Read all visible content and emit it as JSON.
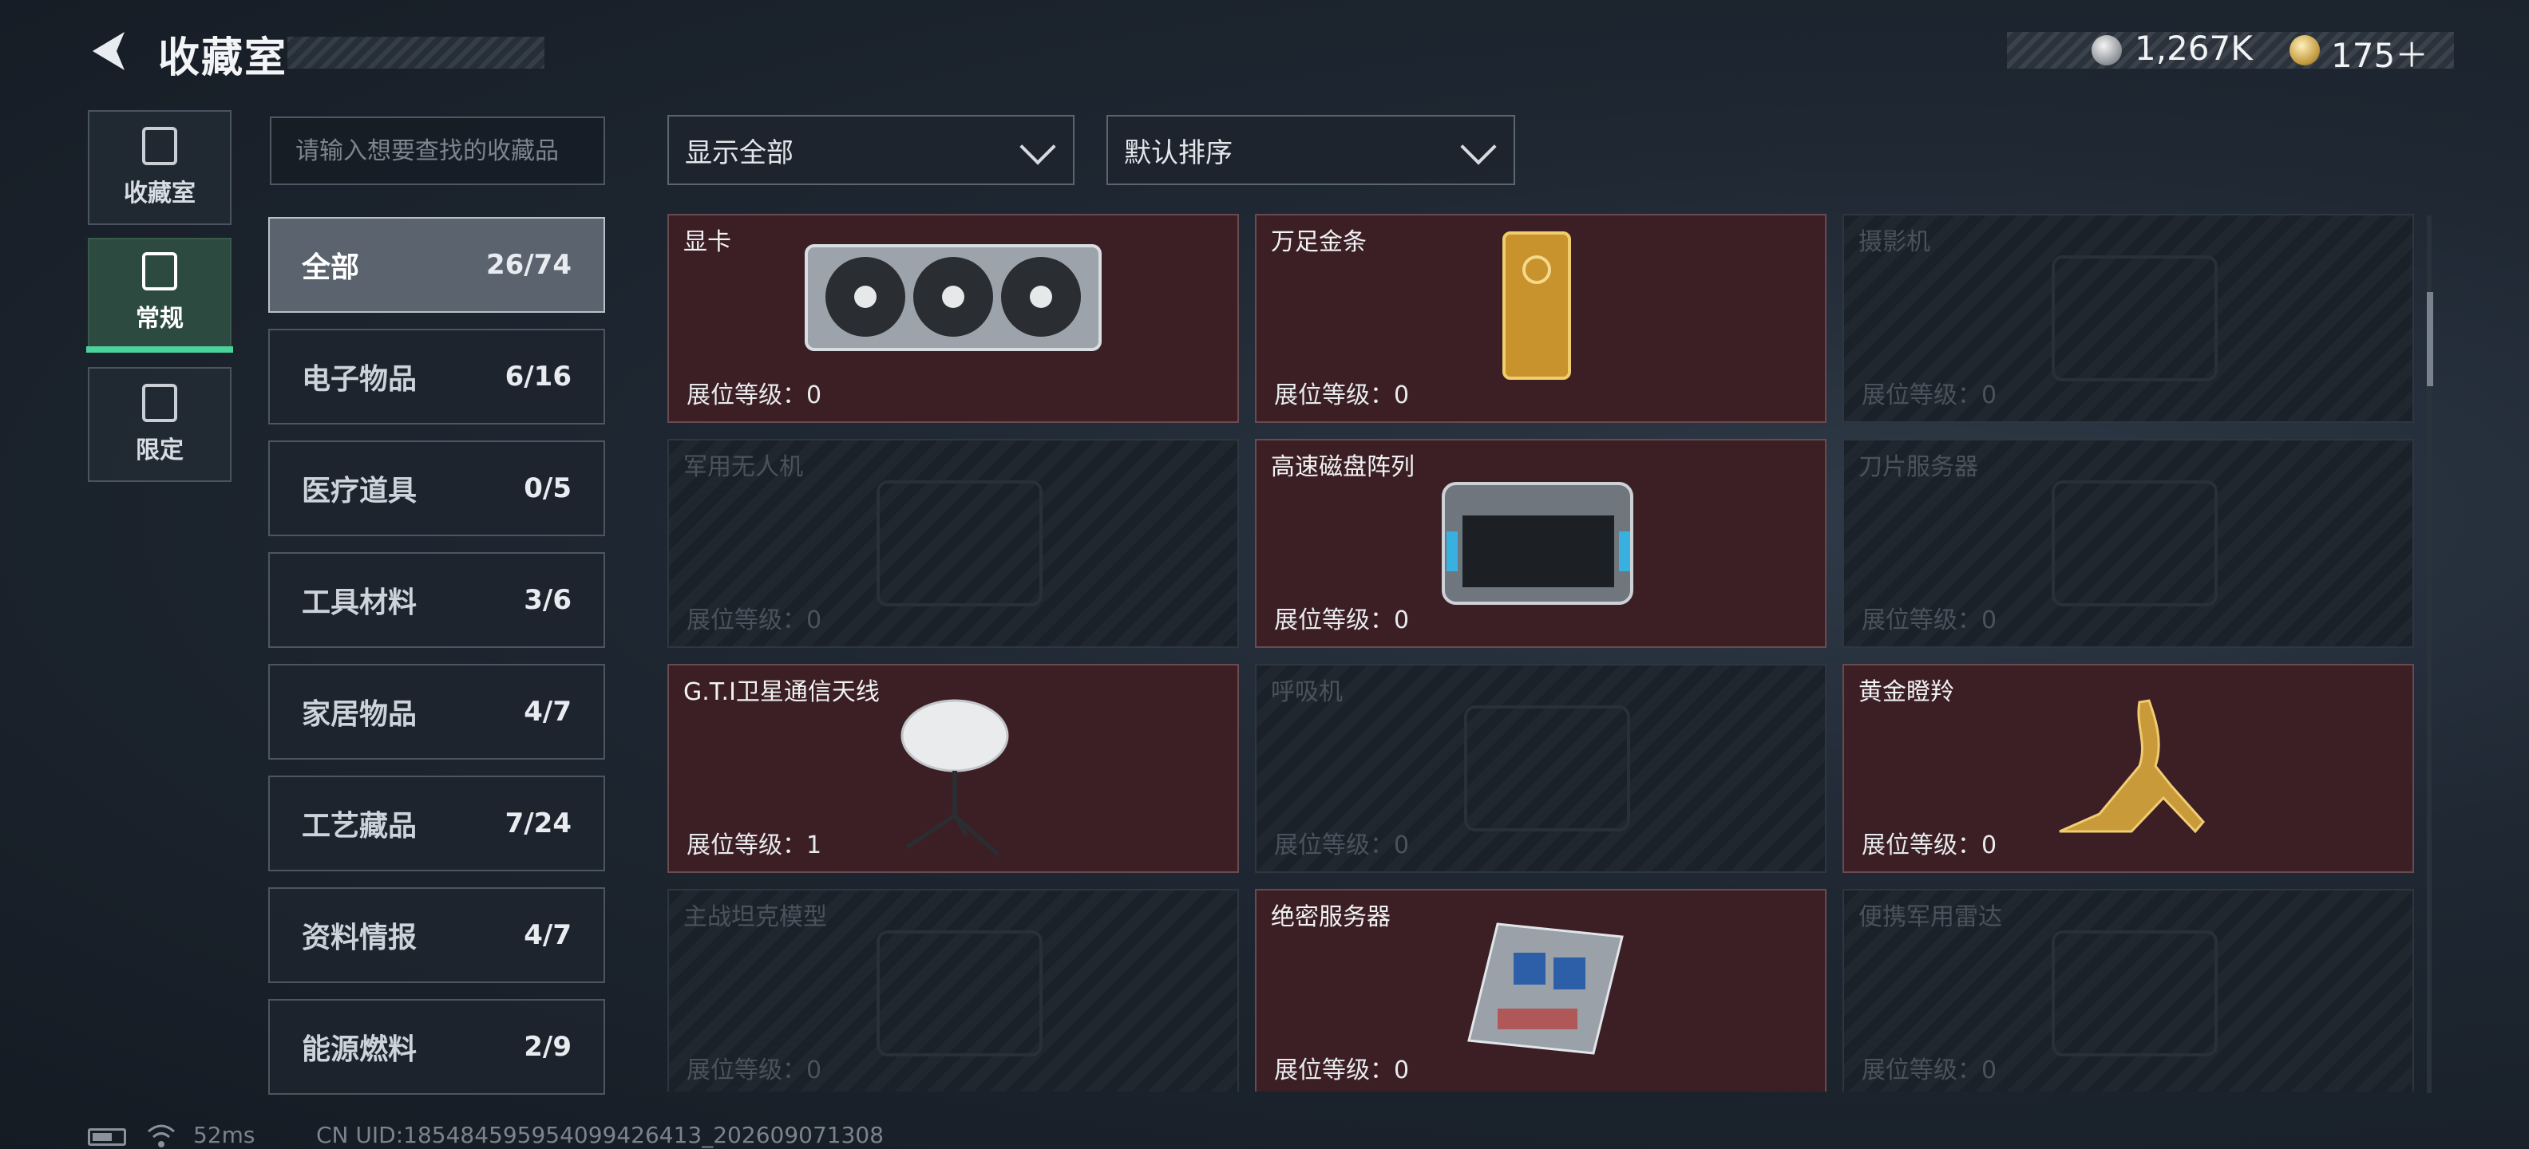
{
  "header": {
    "title": "收藏室",
    "currency_silver": "1,267K",
    "currency_gold": "175＋"
  },
  "side_nav": [
    {
      "label": "收藏室",
      "icon": "collection-icon",
      "active": false
    },
    {
      "label": "常规",
      "icon": "regular-icon",
      "active": true
    },
    {
      "label": "限定",
      "icon": "limited-icon",
      "active": false
    }
  ],
  "search": {
    "placeholder": "请输入想要查找的收藏品"
  },
  "filters": {
    "show": "显示全部",
    "sort": "默认排序"
  },
  "categories": [
    {
      "name": "全部",
      "count": "26/74",
      "active": true
    },
    {
      "name": "电子物品",
      "count": "6/16"
    },
    {
      "name": "医疗道具",
      "count": "0/5"
    },
    {
      "name": "工具材料",
      "count": "3/6"
    },
    {
      "name": "家居物品",
      "count": "4/7"
    },
    {
      "name": "工艺藏品",
      "count": "7/24"
    },
    {
      "name": "资料情报",
      "count": "4/7"
    },
    {
      "name": "能源燃料",
      "count": "2/9"
    }
  ],
  "items": [
    {
      "name": "显卡",
      "level": "展位等级：0",
      "owned": true,
      "icon": "graphics-card-icon"
    },
    {
      "name": "万足金条",
      "level": "展位等级：0",
      "owned": true,
      "icon": "gold-bar-icon"
    },
    {
      "name": "摄影机",
      "level": "展位等级：0",
      "owned": false,
      "icon": "camera-icon"
    },
    {
      "name": "军用无人机",
      "level": "展位等级：0",
      "owned": false,
      "icon": "drone-icon"
    },
    {
      "name": "高速磁盘阵列",
      "level": "展位等级：0",
      "owned": true,
      "icon": "disk-array-icon"
    },
    {
      "name": "刀片服务器",
      "level": "展位等级：0",
      "owned": false,
      "icon": "blade-server-icon"
    },
    {
      "name": "G.T.I卫星通信天线",
      "level": "展位等级：1",
      "owned": true,
      "icon": "satellite-dish-icon"
    },
    {
      "name": "呼吸机",
      "level": "展位等级：0",
      "owned": false,
      "icon": "ventilator-icon"
    },
    {
      "name": "黄金瞪羚",
      "level": "展位等级：0",
      "owned": true,
      "icon": "gold-gazelle-icon"
    },
    {
      "name": "主战坦克模型",
      "level": "展位等级：0",
      "owned": false,
      "icon": "tank-model-icon"
    },
    {
      "name": "绝密服务器",
      "level": "展位等级：0",
      "owned": true,
      "icon": "server-icon"
    },
    {
      "name": "便携军用雷达",
      "level": "展位等级：0",
      "owned": false,
      "icon": "radar-icon"
    }
  ],
  "status": {
    "ping": "52ms",
    "uid": "CN UID:18548459595409942641​3_202609071308"
  }
}
